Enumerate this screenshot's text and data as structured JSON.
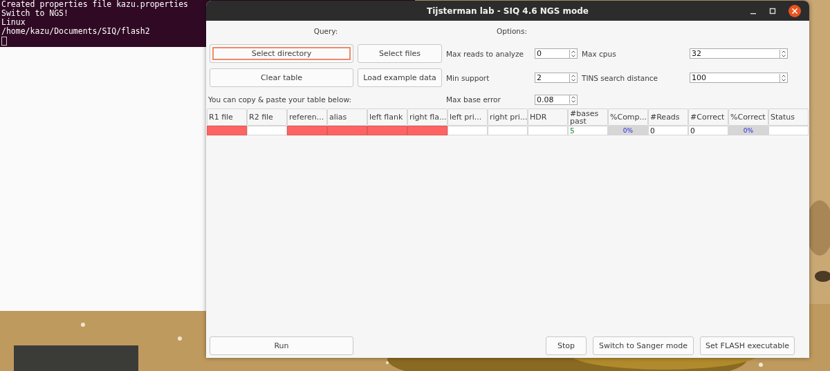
{
  "terminal": {
    "lines": [
      "Created properties file kazu.properties",
      "Switch to NGS!",
      "Linux",
      "/home/kazu/Documents/SIQ/flash2"
    ]
  },
  "window": {
    "title": "Tijsterman lab - SIQ 4.6 NGS mode"
  },
  "query": {
    "heading": "Query:",
    "buttons": [
      {
        "label": "Select directory",
        "focused": true
      },
      {
        "label": "Select files",
        "focused": false
      },
      {
        "label": "Clear table",
        "focused": false
      },
      {
        "label": "Load example data",
        "focused": false
      }
    ],
    "hint": "You can copy & paste your table below:"
  },
  "options": {
    "heading": "Options:",
    "fields": [
      {
        "label": "Max reads to analyze",
        "value": "0"
      },
      {
        "label": "Max cpus",
        "value": "32"
      },
      {
        "label": "Min support",
        "value": "2"
      },
      {
        "label": "TINS search distance",
        "value": "100"
      },
      {
        "label": "Max base error",
        "value": "0.08"
      }
    ]
  },
  "table": {
    "columns": [
      "R1 file",
      "R2 file",
      "referen...",
      "alias",
      "left flank",
      "right fla...",
      "left pri...",
      "right pri...",
      "HDR",
      "#bases past",
      "%Comp...",
      "#Reads",
      "#Correct",
      "%Correct",
      "Status"
    ],
    "rows": [
      {
        "cells": [
          {
            "kind": "text",
            "invalid": true
          },
          {
            "kind": "text",
            "invalid": false
          },
          {
            "kind": "text",
            "invalid": true
          },
          {
            "kind": "text",
            "invalid": true
          },
          {
            "kind": "text",
            "invalid": true
          },
          {
            "kind": "text",
            "invalid": true
          },
          {
            "kind": "text",
            "invalid": false
          },
          {
            "kind": "text",
            "invalid": false
          },
          {
            "kind": "text",
            "invalid": false
          },
          {
            "kind": "text",
            "invalid": false,
            "text": "5",
            "color": "#1a8a3a"
          },
          {
            "kind": "progress",
            "level": 0,
            "text": "0%"
          },
          {
            "kind": "text",
            "invalid": false,
            "text": "0"
          },
          {
            "kind": "text",
            "invalid": false,
            "text": "0"
          },
          {
            "kind": "progress",
            "level": 0,
            "text": "0%"
          },
          {
            "kind": "text",
            "invalid": false
          }
        ]
      }
    ]
  },
  "bottom_buttons": [
    "Run",
    "Stop",
    "Switch to Sanger mode",
    "Set FLASH executable"
  ]
}
